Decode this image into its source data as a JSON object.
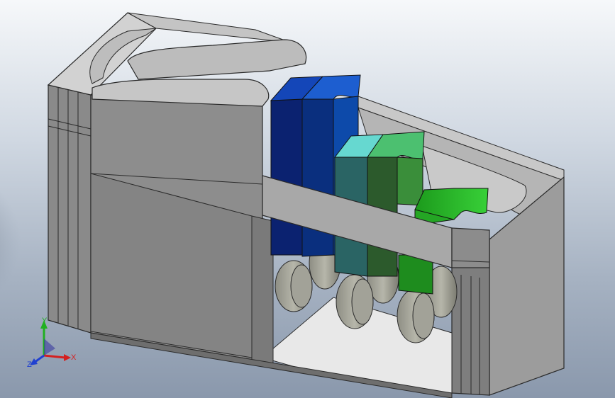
{
  "viewport": {
    "background_top": "#f4f6f9",
    "background_bottom": "#8e9cb0"
  },
  "model": {
    "body_color": "#9a9a9a",
    "shadow_color": "#4a4e55",
    "slots": [
      {
        "name": "slot-1",
        "front_color": "#0b2f8a",
        "side_color": "#06195a",
        "top_color": "#1a56c8"
      },
      {
        "name": "slot-2",
        "front_color": "#2a6a6a",
        "side_color": "#1e4e4e",
        "top_color": "#64d0d8"
      },
      {
        "name": "slot-3",
        "front_color": "#2da02d",
        "side_color": "#1e6e1e",
        "top_color": "#4ce04c"
      }
    ],
    "wheel_color": "#a6a69a"
  },
  "triad": {
    "x_label": "X",
    "y_label": "Y",
    "z_label": "Z",
    "x_color": "#d42020",
    "y_color": "#20b020",
    "z_color": "#2040d0"
  }
}
